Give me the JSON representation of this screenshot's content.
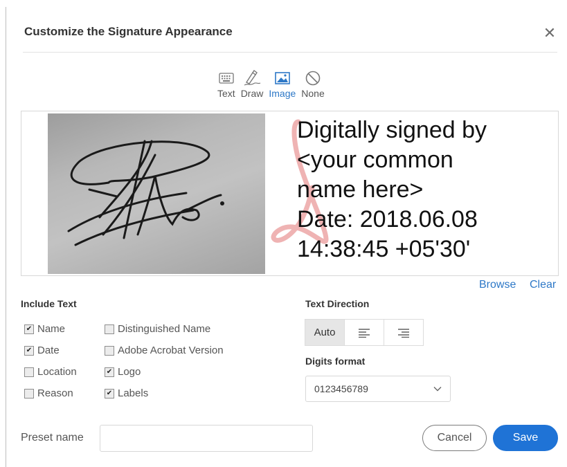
{
  "dialog": {
    "title": "Customize the Signature Appearance",
    "close_icon": "close-icon"
  },
  "mode_tabs": [
    {
      "label": "Text",
      "icon": "keyboard-icon"
    },
    {
      "label": "Draw",
      "icon": "pen-icon"
    },
    {
      "label": "Image",
      "icon": "image-icon",
      "active": true
    },
    {
      "label": "None",
      "icon": "none-icon"
    }
  ],
  "preview": {
    "signature_lines": [
      "Digitally signed by",
      "<your common",
      "name here>",
      "Date: 2018.06.08",
      "14:38:45 +05'30'"
    ]
  },
  "image_actions": {
    "browse": "Browse",
    "clear": "Clear"
  },
  "include_text": {
    "heading": "Include Text",
    "options": [
      {
        "label": "Name",
        "checked": true
      },
      {
        "label": "Date",
        "checked": true
      },
      {
        "label": "Location",
        "checked": false
      },
      {
        "label": "Reason",
        "checked": false
      },
      {
        "label": "Distinguished Name",
        "checked": false
      },
      {
        "label": "Adobe Acrobat Version",
        "checked": false
      },
      {
        "label": "Logo",
        "checked": true
      },
      {
        "label": "Labels",
        "checked": true
      }
    ]
  },
  "text_direction": {
    "heading": "Text Direction",
    "auto_label": "Auto",
    "selected": "Auto",
    "icons": [
      "align-left-icon",
      "align-right-icon"
    ]
  },
  "digits_format": {
    "heading": "Digits format",
    "value": "0123456789"
  },
  "preset": {
    "label": "Preset name",
    "value": ""
  },
  "buttons": {
    "cancel": "Cancel",
    "save": "Save"
  },
  "colors": {
    "accent": "#1f73d6",
    "link": "#2d78c7",
    "text": "#333333"
  }
}
